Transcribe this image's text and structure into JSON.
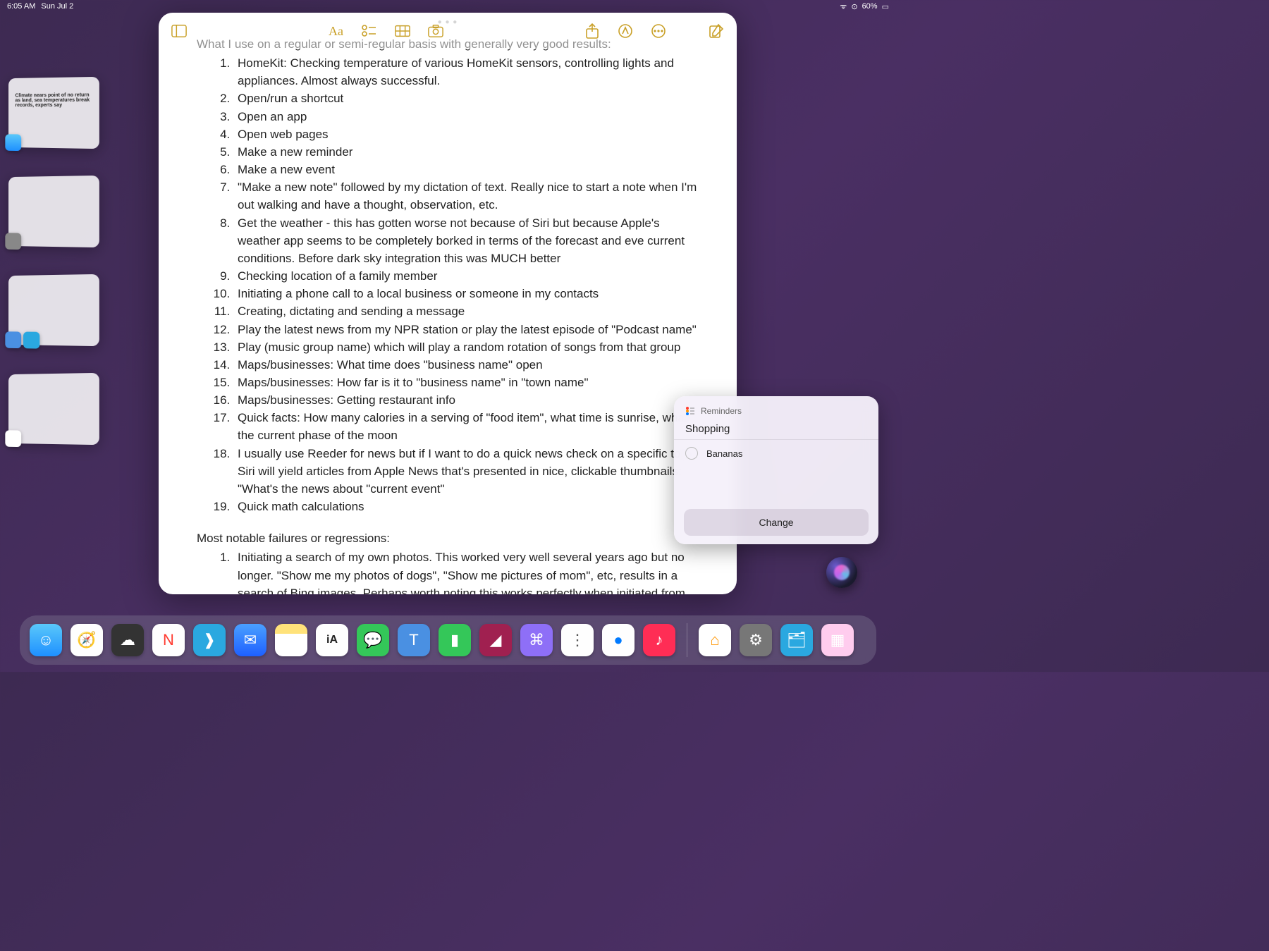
{
  "status": {
    "time": "6:05 AM",
    "date": "Sun Jul 2",
    "battery": "60%"
  },
  "stage_strip": {
    "items": [
      {
        "headline": "Climate nears point of no return as land, sea temperatures break records, experts say"
      },
      {},
      {},
      {}
    ]
  },
  "notes": {
    "intro": "What I use on a regular or semi-regular basis with generally very good results:",
    "list": [
      "HomeKit: Checking temperature of various HomeKit sensors, controlling lights and appliances. Almost always successful.",
      "Open/run a shortcut",
      "Open an app",
      "Open web pages",
      "Make a new reminder",
      "Make a new event",
      "\"Make a new note\" followed by my dictation of text. Really nice to start a note when I'm out walking and have a thought, observation, etc.",
      "Get the weather - this has gotten worse not because of Siri but because Apple's weather app seems to be completely borked in terms of the forecast and eve current conditions. Before dark sky integration this was MUCH better",
      "Checking location of a family member",
      "Initiating a phone call to a local business or someone in my contacts",
      "Creating, dictating and sending a message",
      "Play the latest news from my NPR station or play the latest episode of \"Podcast name\"",
      "Play (music group name) which will play a random rotation of songs from that group",
      "Maps/businesses: What time does \"business name\" open",
      "Maps/businesses: How far is it to \"business name\" in \"town name\"",
      "Maps/businesses: Getting restaurant info",
      "Quick facts: How many calories in a serving of \"food item\", what time is sunrise, what's the current phase of the moon",
      "I usually use Reeder for news but if I want to do a quick news check on a specific topic Siri will yield articles from Apple News that's presented in nice, clickable thumbnails: \"What's the news about \"current event\"",
      "Quick math calculations"
    ],
    "failures_heading": "Most notable failures or regressions:",
    "failures": [
      "Initiating a search of my own photos. This worked very well several years ago but no longer. \"Show me my photos of dogs\", \"Show me pictures of mom\", etc, results in a search of Bing images. Perhaps worth noting this works perfectly when initiated from"
    ]
  },
  "reminders": {
    "app_label": "Reminders",
    "list_name": "Shopping",
    "item": "Bananas",
    "button": "Change"
  },
  "dock": {
    "apps": [
      {
        "name": "finder",
        "bg": "linear-gradient(#5ac8fa,#1e90ff)",
        "glyph": "☺"
      },
      {
        "name": "safari",
        "bg": "#fefefe",
        "glyph": "🧭"
      },
      {
        "name": "weather",
        "bg": "#333",
        "glyph": "☁"
      },
      {
        "name": "news",
        "bg": "#fefefe",
        "glyph": "N",
        "color": "#ff3b30"
      },
      {
        "name": "goodnotes",
        "bg": "#2aa8e0",
        "glyph": "❱"
      },
      {
        "name": "mail",
        "bg": "linear-gradient(#4aa0ff,#1e60ff)",
        "glyph": "✉"
      },
      {
        "name": "notes",
        "bg": "linear-gradient(#ffe27a 30%,#fff 30%)",
        "glyph": ""
      },
      {
        "name": "ia-writer",
        "bg": "#fefefe",
        "glyph": "iA",
        "color": "#222"
      },
      {
        "name": "messages",
        "bg": "#34c759",
        "glyph": "💬"
      },
      {
        "name": "tot",
        "bg": "#4a90e2",
        "glyph": "T"
      },
      {
        "name": "numbers",
        "bg": "#34c759",
        "glyph": "▮"
      },
      {
        "name": "affinity",
        "bg": "#a02050",
        "glyph": "◢"
      },
      {
        "name": "shortcuts-alt",
        "bg": "#8e6ff7",
        "glyph": "⌘"
      },
      {
        "name": "reminders",
        "bg": "#fefefe",
        "glyph": "⋮",
        "color": "#555"
      },
      {
        "name": "things",
        "bg": "#fefefe",
        "glyph": "●",
        "color": "#007aff"
      },
      {
        "name": "music",
        "bg": "#ff2d55",
        "glyph": "♪"
      }
    ],
    "recents": [
      {
        "name": "home",
        "bg": "#fff",
        "glyph": "⌂",
        "color": "#ff9500"
      },
      {
        "name": "settings",
        "bg": "#777",
        "glyph": "⚙"
      },
      {
        "name": "files",
        "bg": "#2aa8e0",
        "glyph": "🗂"
      },
      {
        "name": "split",
        "bg": "#fce",
        "glyph": "▦"
      }
    ]
  }
}
